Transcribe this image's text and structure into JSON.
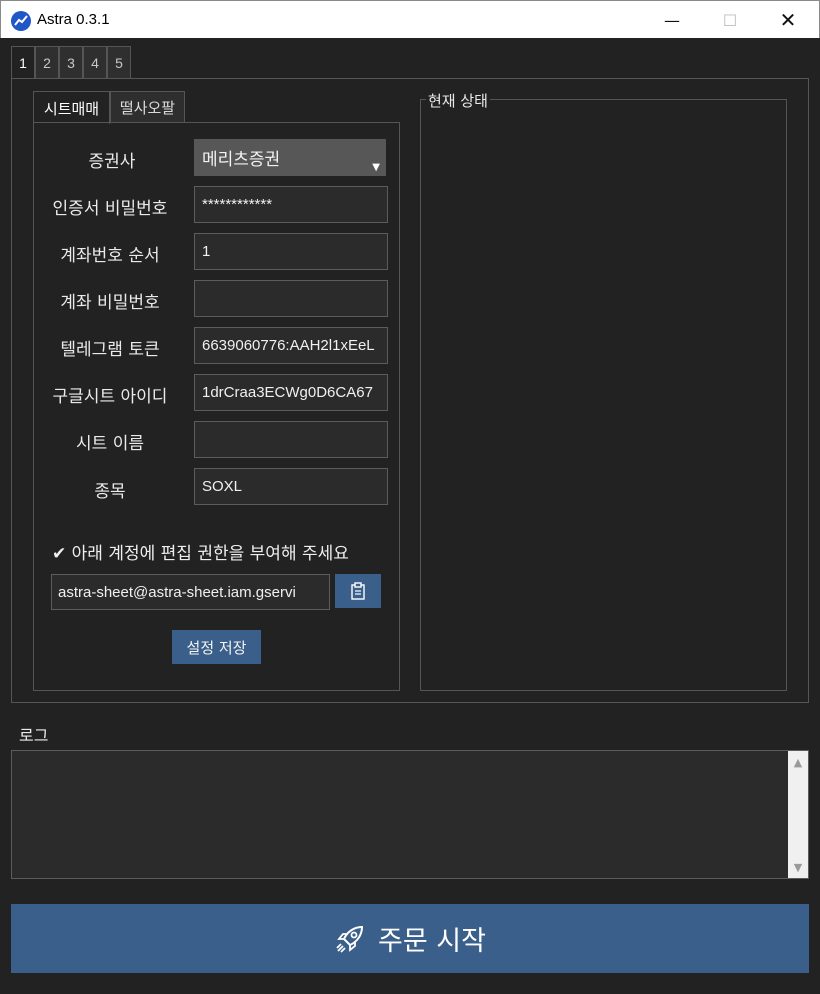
{
  "window": {
    "title": "Astra 0.3.1",
    "minimize": "—",
    "maximize": "☐",
    "close": "✕"
  },
  "outer_tabs": [
    "1",
    "2",
    "3",
    "4",
    "5"
  ],
  "inner_tabs": [
    "시트매매",
    "떨사오팔"
  ],
  "form": {
    "broker_label": "증권사",
    "broker_value": "메리츠증권",
    "cert_pw_label": "인증서 비밀번호",
    "cert_pw_value": "************",
    "acct_order_label": "계좌번호 순서",
    "acct_order_value": "1",
    "acct_pw_label": "계좌 비밀번호",
    "acct_pw_value": "",
    "telegram_label": "텔레그램 토큰",
    "telegram_value": "6639060776:AAH2l1xEeL",
    "sheet_id_label": "구글시트 아이디",
    "sheet_id_value": "1drCraa3ECWg0D6CA67",
    "sheet_name_label": "시트 이름",
    "sheet_name_value": "",
    "ticker_label": "종목",
    "ticker_value": "SOXL"
  },
  "notice": "✔ 아래 계정에 편집 권한을 부여해 주세요",
  "service_email": "astra-sheet@astra-sheet.iam.gservi",
  "save_button": "설정 저장",
  "status": {
    "title": "현재 상태"
  },
  "log": {
    "title": "로그"
  },
  "start_button": "주문 시작",
  "colors": {
    "accent": "#3a5f8a",
    "background": "#222222",
    "field": "#2b2b2b"
  }
}
